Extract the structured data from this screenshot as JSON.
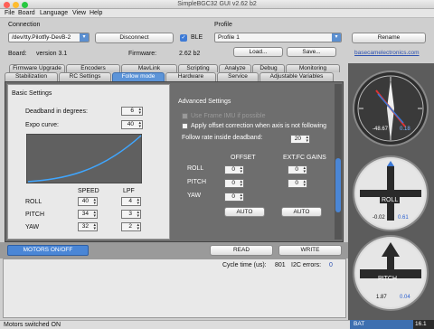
{
  "window": {
    "title": "SimpleBGC32 GUI v2.62 b2"
  },
  "menu": [
    "File",
    "Board",
    "Language",
    "View",
    "Help"
  ],
  "connection": {
    "label": "Connection",
    "port": "/dev/tty.Pilotfly-DevB-2",
    "disconnect": "Disconnect",
    "ble": "BLE",
    "board_label": "Board:",
    "board_version": "version 3.1",
    "firmware_label": "Firmware:",
    "firmware_version": "2.62 b2"
  },
  "profile": {
    "label": "Profile",
    "value": "Profile 1",
    "rename": "Rename",
    "load": "Load...",
    "save": "Save...",
    "link": "basecamelectronics.com"
  },
  "tabs_back": [
    "Firmware Upgrade",
    "Encoders",
    "MavLink",
    "Scripting",
    "Analyze",
    "Debug",
    "Monitoring"
  ],
  "tabs_front": [
    "Stabilization",
    "RC Settings",
    "Follow mode",
    "Hardware",
    "Service",
    "Adjustable Variables"
  ],
  "basic": {
    "title": "Basic Settings",
    "deadband_label": "Deadband in degrees:",
    "deadband": "6",
    "expo_label": "Expo curve:",
    "expo": "40",
    "speed_header": "SPEED",
    "lpf_header": "LPF",
    "rows": [
      {
        "axis": "ROLL",
        "speed": "40",
        "lpf": "4"
      },
      {
        "axis": "PITCH",
        "speed": "34",
        "lpf": "3"
      },
      {
        "axis": "YAW",
        "speed": "32",
        "lpf": "2"
      }
    ]
  },
  "advanced": {
    "title": "Advanced Settings",
    "use_frame_imu": "Use Frame IMU if possible",
    "apply_offset": "Apply offset correction when axis is not following",
    "follow_rate_label": "Follow rate inside deadband:",
    "follow_rate": "20",
    "offset_header": "OFFSET",
    "ext_header": "EXT.FC GAINS",
    "rows": [
      {
        "axis": "ROLL",
        "offset": "0",
        "ext": "0"
      },
      {
        "axis": "PITCH",
        "offset": "0",
        "ext": "0"
      },
      {
        "axis": "YAW",
        "offset": "0"
      }
    ],
    "auto1": "AUTO",
    "auto2": "AUTO"
  },
  "actions": {
    "motors": "MOTORS ON/OFF",
    "read": "READ",
    "write": "WRITE",
    "cycle_label": "Cycle time (us):",
    "cycle_value": "801",
    "i2c_label": "I2C errors:",
    "i2c_value": "0"
  },
  "gauges": [
    {
      "value": "-48.67",
      "value2": "0.18",
      "label": ""
    },
    {
      "value": "-0.02",
      "value2": "0.61",
      "label": "ROLL"
    },
    {
      "value": "1.87",
      "value2": "0.04",
      "label": "PITCH"
    }
  ],
  "battery": {
    "label": "BAT",
    "value": "16.1"
  },
  "status": {
    "text": "Motors switched ON"
  },
  "colors": {
    "accent": "#5c94d8",
    "panel": "#6e6e6e",
    "curve": "#3fa6ff"
  },
  "icons": {
    "close": "close-icon",
    "minimize": "minimize-icon",
    "maximize": "maximize-icon",
    "dropdown": "chevron-down-icon"
  }
}
